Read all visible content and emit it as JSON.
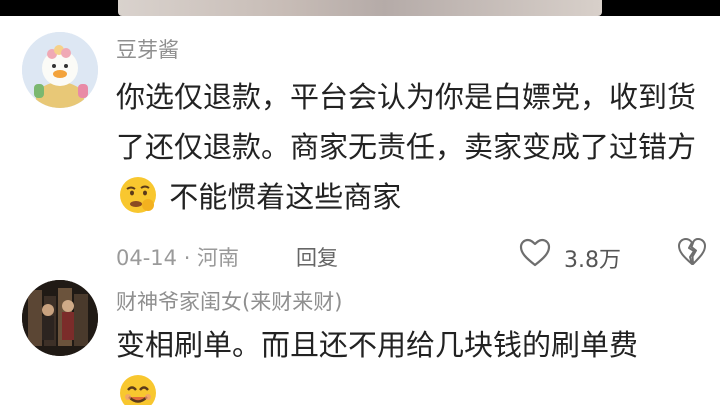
{
  "comments": [
    {
      "username": "豆芽酱",
      "text_part1": "你选仅退款，平台会认为你是白嫖党，收到货了还仅退款。商家无责任，卖家变成了过错方",
      "text_emoji": "thinking-face-emoji",
      "text_part2": "不能惯着这些商家",
      "date_location": "04-14 · 河南",
      "reply_label": "回复",
      "like_count": "3.8万",
      "avatar_icon": "duck-avatar-icon"
    },
    {
      "username": "财神爷家闺女(来财来财)",
      "text_part1": "变相刷单。而且还不用给几块钱的刷单费",
      "text_emoji": "smiling-face-emoji",
      "avatar_icon": "photo-avatar-icon"
    }
  ],
  "colors": {
    "panel_background": "#ffffff",
    "username": "#8f8f8f",
    "body_text": "#222222",
    "meta_text": "#9a9a9a"
  }
}
